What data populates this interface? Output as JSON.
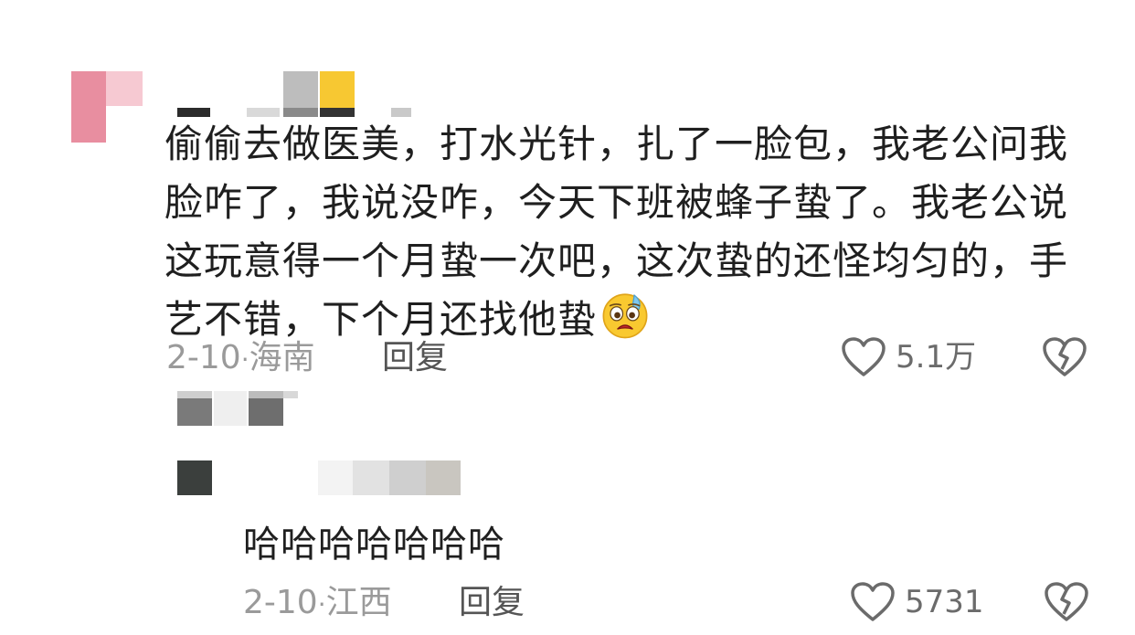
{
  "comment": {
    "text": "偷偷去做医美，打水光针，扎了一脸包，我老公问我脸咋了，我说没咋，今天下班被蜂子蛰了。我老公说这玩意得一个月蛰一次吧，这次蛰的还怪均匀的，手艺不错，下个月还找他蛰",
    "emoji": "anxious-sweat-face-emoji",
    "date": "2-10",
    "location": "海南",
    "reply_label": "回复",
    "likes": "5.1万",
    "heart_icon": "heart-outline-icon",
    "dislike_icon": "broken-heart-icon"
  },
  "reply": {
    "text": "哈哈哈哈哈哈哈",
    "date": "2-10",
    "location": "江西",
    "reply_label": "回复",
    "likes": "5731",
    "heart_icon": "heart-outline-icon",
    "dislike_icon": "broken-heart-icon"
  },
  "colors": {
    "text": "#1f1f1f",
    "meta": "#9a9a9a",
    "icon": "#6b6b6b"
  }
}
